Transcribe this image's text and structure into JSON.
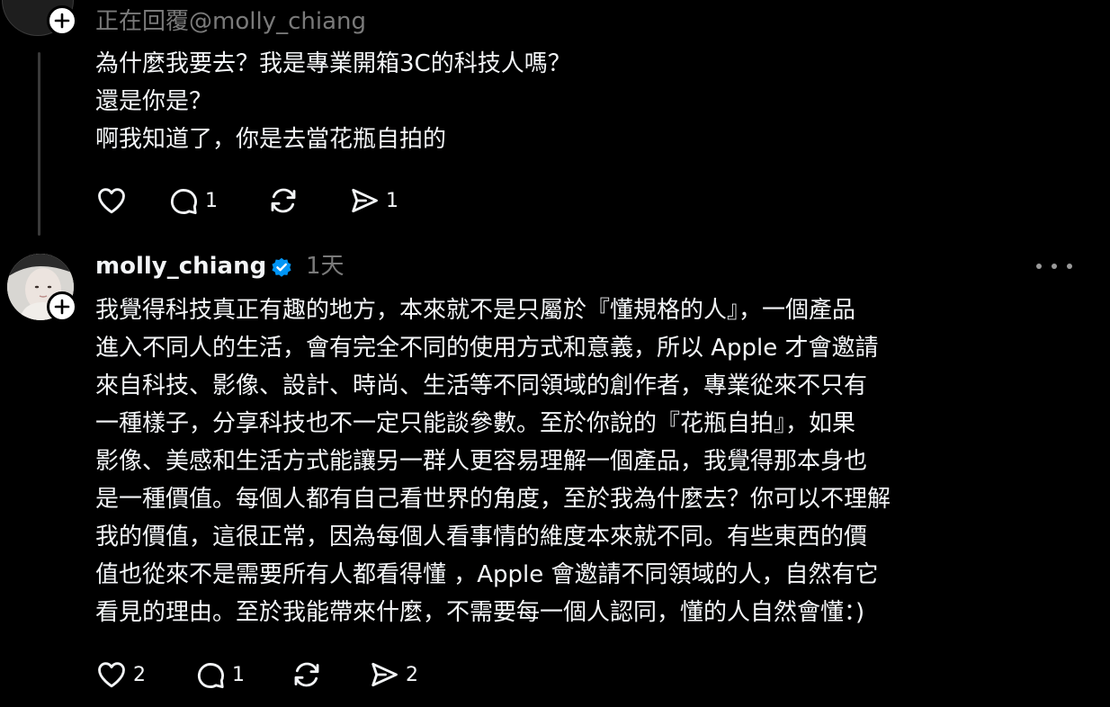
{
  "reply_post": {
    "reply_to_text": "正在回覆@molly_chiang",
    "lines": [
      "為什麼我要去？我是專業開箱3C的科技人嗎？",
      "還是你是？",
      "啊我知道了，你是去當花瓶自拍的"
    ],
    "actions": {
      "like_icon": "heart-icon",
      "like_count": "",
      "comment_icon": "comment-icon",
      "comment_count": "1",
      "repost_icon": "repost-icon",
      "share_icon": "share-icon",
      "share_count": "1"
    }
  },
  "main_post": {
    "username": "molly_chiang",
    "verified_icon": "verified-badge-icon",
    "time": "1天",
    "more_icon": "more-options-icon",
    "lines": [
      "我覺得科技真正有趣的地方，本來就不是只屬於『懂規格的人』，一個產品",
      "進入不同人的生活，會有完全不同的使用方式和意義，所以 Apple 才會邀請",
      "來自科技、影像、設計、時尚、生活等不同領域的創作者，專業從來不只有",
      "一種樣子，分享科技也不一定只能談參數。至於你說的『花瓶自拍』，如果",
      "影像、美感和生活方式能讓另一群人更容易理解一個產品，我覺得那本身也",
      "是一種價值。每個人都有自己看世界的角度，至於我為什麼去？你可以不理解",
      "我的價值，這很正常，因為每個人看事情的維度本來就不同。有些東西的價",
      "值也從來不是需要所有人都看得懂 ，Apple 會邀請不同領域的人，自然有它",
      "看見的理由。至於我能帶來什麼，不需要每一個人認同，懂的人自然會懂：)"
    ],
    "actions": {
      "like_icon": "heart-icon",
      "like_count": "2",
      "comment_icon": "comment-icon",
      "comment_count": "1",
      "repost_icon": "repost-icon",
      "share_icon": "share-icon",
      "share_count": "2"
    }
  },
  "colors": {
    "background": "#000000",
    "text_primary": "#f3f5f7",
    "text_secondary": "#7a7a7a",
    "verified_blue": "#0095f6",
    "thread_line": "#3a3a3a"
  }
}
